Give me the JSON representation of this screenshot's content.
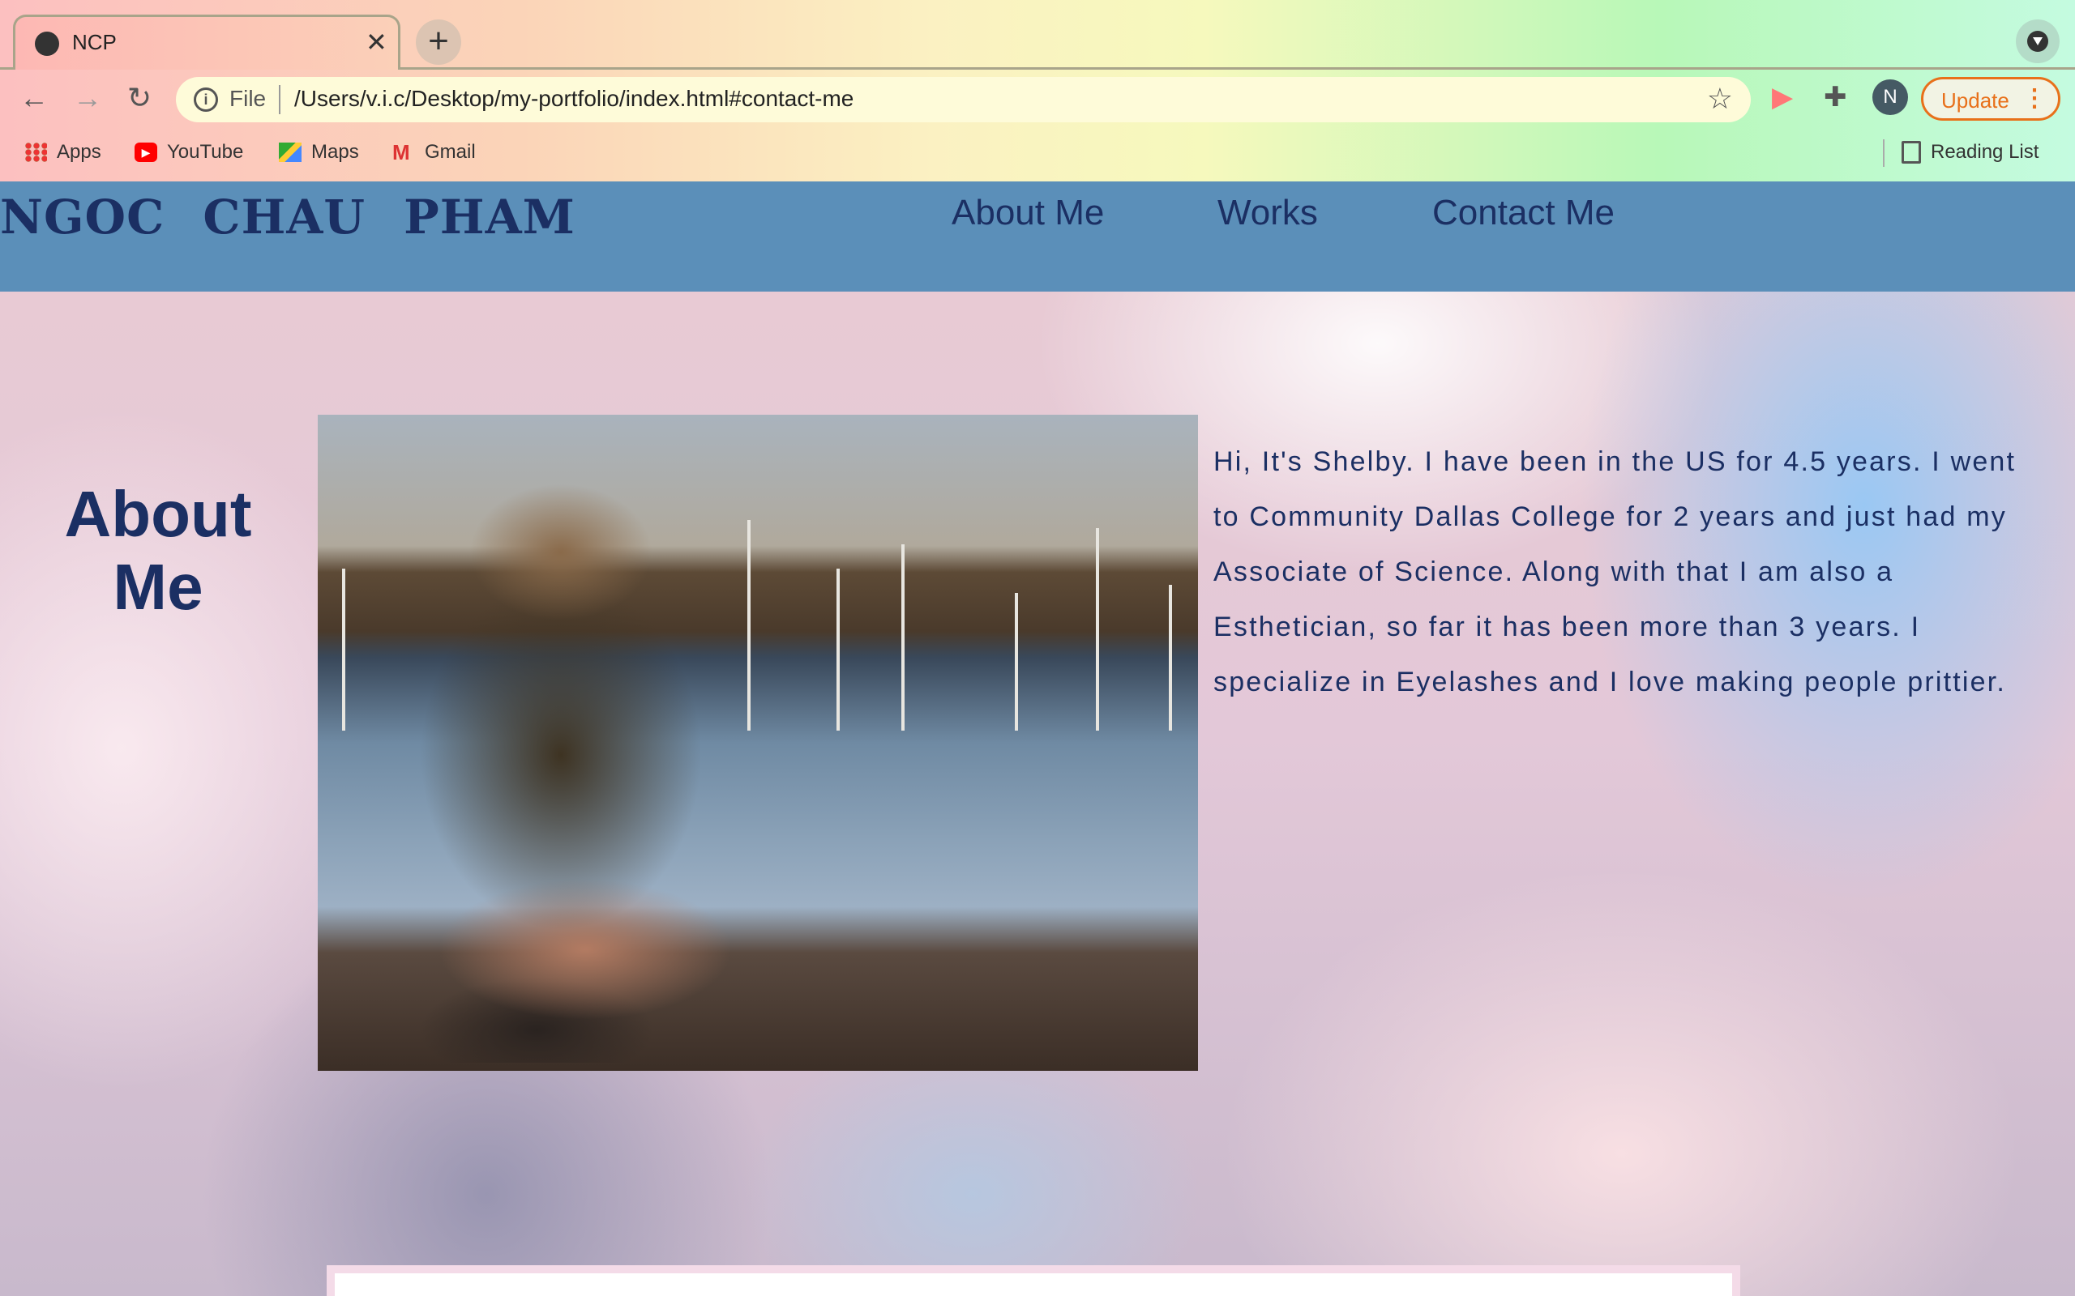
{
  "browser": {
    "tab": {
      "title": "NCP",
      "icon": "globe-icon"
    },
    "url_scheme_label": "File",
    "url": "/Users/v.i.c/Desktop/my-portfolio/index.html#contact-me",
    "profile_initial": "N",
    "update_label": "Update",
    "bookmarks": [
      {
        "label": "Apps",
        "icon": "apps-grid-icon"
      },
      {
        "label": "YouTube",
        "icon": "youtube-icon"
      },
      {
        "label": "Maps",
        "icon": "maps-icon"
      },
      {
        "label": "Gmail",
        "icon": "gmail-icon"
      }
    ],
    "reading_list": "Reading List",
    "accent_update": "#e8701a"
  },
  "site": {
    "brand": "NGOC CHAU PHAM",
    "nav": [
      "About Me",
      "Works",
      "Contact Me"
    ],
    "nav_color": "#5b8fb9",
    "text_color": "#1b2f63",
    "about": {
      "heading_line1": "About",
      "heading_line2": "Me",
      "bio_lines": [
        "Hi, It's Shelby. I have been in the US for 4.5 years. I went",
        "to Community Dallas College for 2 years and just had my",
        "Associate of Science. Along with that I am also a",
        "Esthetician, so far it has been more than 3 years. I",
        "specialize in Eyelashes and I love making people prittier."
      ]
    }
  }
}
